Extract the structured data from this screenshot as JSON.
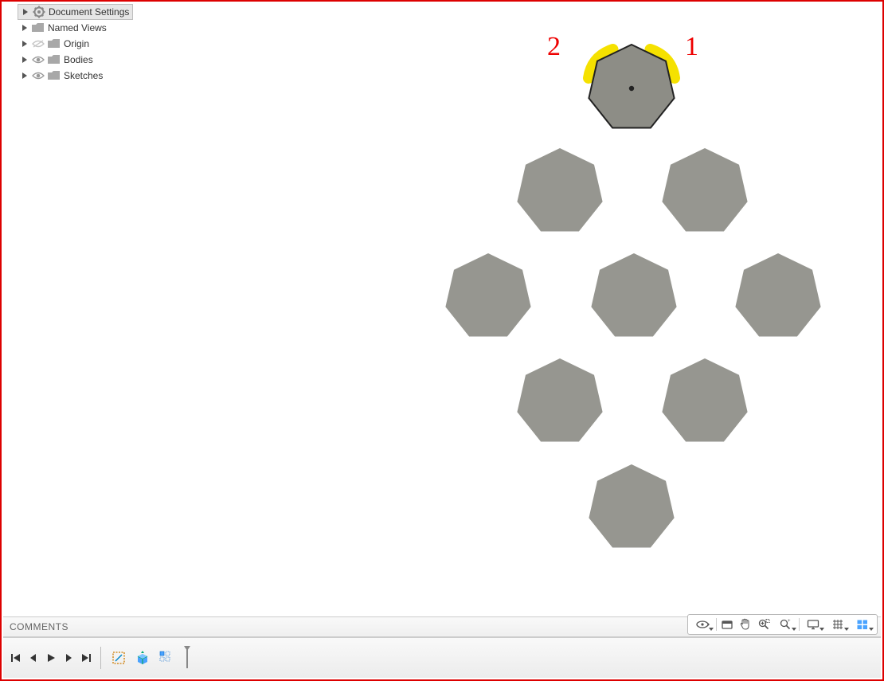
{
  "browser": {
    "items": [
      {
        "label": "Document Settings",
        "icon": "gear",
        "selected": true,
        "visible": null
      },
      {
        "label": "Named Views",
        "icon": "folder",
        "selected": false,
        "visible": null
      },
      {
        "label": "Origin",
        "icon": "folder",
        "selected": false,
        "visible": "hidden"
      },
      {
        "label": "Bodies",
        "icon": "folder",
        "selected": false,
        "visible": "shown"
      },
      {
        "label": "Sketches",
        "icon": "folder",
        "selected": false,
        "visible": "shown"
      }
    ]
  },
  "annotations": {
    "left": "2",
    "right": "1"
  },
  "comments": {
    "title": "COMMENTS"
  },
  "navbar": {
    "items": [
      "orbit",
      "lookat",
      "pan",
      "zoom-window",
      "zoom",
      "display",
      "grid",
      "viewports"
    ]
  },
  "timeline": {
    "controls": [
      "first",
      "prev",
      "play",
      "next",
      "last"
    ],
    "features": [
      "sketch",
      "extrude",
      "rect-pattern"
    ]
  },
  "bodies": {
    "count": 9,
    "highlighted_index": 0,
    "annotation_edges": [
      "top-right",
      "top-left"
    ]
  }
}
